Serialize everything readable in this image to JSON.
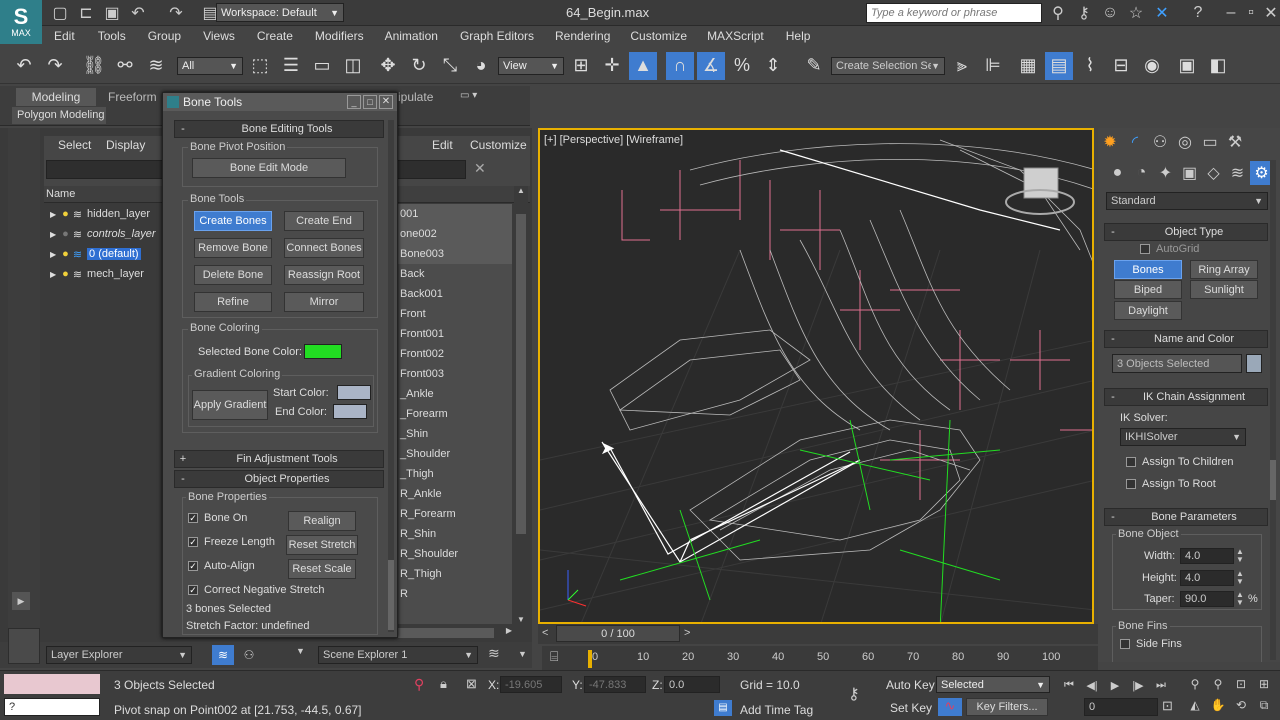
{
  "title_bar": {
    "logo_text": "MAX",
    "workspace": "Workspace: Default",
    "file_title": "64_Begin.max",
    "search_placeholder": "Type a keyword or phrase"
  },
  "menu": [
    "Edit",
    "Tools",
    "Group",
    "Views",
    "Create",
    "Modifiers",
    "Animation",
    "Graph Editors",
    "Rendering",
    "Customize",
    "MAXScript",
    "Help"
  ],
  "main_toolbar": {
    "filter": "All",
    "ref_coord": "View",
    "selection_set_placeholder": "Create Selection Se"
  },
  "ribbon": {
    "tabs": [
      "Modeling",
      "Freeform"
    ],
    "partial_tab": "ipulate",
    "sub": "Polygon Modeling"
  },
  "scene_explorer": {
    "tabs": [
      "Select",
      "Display"
    ],
    "tabs_right": [
      "Edit",
      "Customize"
    ],
    "header": "Name",
    "layers": [
      {
        "name": "hidden_layer",
        "italic": false,
        "selected": false
      },
      {
        "name": "controls_layer",
        "italic": true,
        "selected": false
      },
      {
        "name": "0 (default)",
        "italic": false,
        "selected": true
      },
      {
        "name": "mech_layer",
        "italic": false,
        "selected": false
      }
    ],
    "right_rows": [
      "001",
      "one002",
      "Bone003",
      "Back",
      "Back001",
      "Front",
      "Front001",
      "Front002",
      "Front003",
      "_Ankle",
      "_Forearm",
      "_Shin",
      "_Shoulder",
      "_Thigh",
      "R_Ankle",
      "R_Forearm",
      "R_Shin",
      "R_Shoulder",
      "R_Thigh",
      "R"
    ],
    "bottom_left": "Layer Explorer",
    "bottom_right": "Scene Explorer 1"
  },
  "bone_tools": {
    "title": "Bone Tools",
    "editing_rollout": "Bone Editing Tools",
    "pivot_group": "Bone Pivot Position",
    "bone_edit_mode": "Bone Edit Mode",
    "tools_group": "Bone Tools",
    "create_bones": "Create Bones",
    "create_end": "Create End",
    "remove_bone": "Remove Bone",
    "connect_bones": "Connect Bones",
    "delete_bone": "Delete Bone",
    "reassign_root": "Reassign Root",
    "refine": "Refine",
    "mirror": "Mirror",
    "coloring_group": "Bone Coloring",
    "selected_bone_color_label": "Selected Bone Color:",
    "selected_bone_color": "#22dd22",
    "gradient_group": "Gradient Coloring",
    "apply_gradient": "Apply Gradient",
    "start_color_label": "Start Color:",
    "end_color_label": "End Color:",
    "gradient_swatch_color": "#aab4c6",
    "fin_rollout": "Fin Adjustment Tools",
    "object_rollout": "Object Properties",
    "props_group": "Bone Properties",
    "bone_on": "Bone On",
    "realign": "Realign",
    "freeze_length": "Freeze Length",
    "reset_stretch": "Reset Stretch",
    "auto_align": "Auto-Align",
    "reset_scale": "Reset Scale",
    "correct_negative_stretch": "Correct Negative Stretch",
    "bones_selected": "3 bones Selected",
    "stretch_factor": "Stretch Factor: undefined"
  },
  "viewport": {
    "label": "[+] [Perspective] [Wireframe]",
    "frame_counter": "0 / 100"
  },
  "command_panel": {
    "category": "Standard",
    "object_type_rollout": "Object Type",
    "autogrid": "AutoGrid",
    "bones": "Bones",
    "ring_array": "Ring Array",
    "biped": "Biped",
    "sunlight": "Sunlight",
    "daylight": "Daylight",
    "name_color_rollout": "Name and Color",
    "name_field": "3 Objects Selected",
    "ik_rollout": "IK Chain Assignment",
    "ik_solver_label": "IK Solver:",
    "ik_solver": "IKHISolver",
    "assign_children": "Assign To Children",
    "assign_root": "Assign To Root",
    "bone_params_rollout": "Bone Parameters",
    "bone_object_group": "Bone Object",
    "width_label": "Width:",
    "width": "4.0",
    "height_label": "Height:",
    "height": "4.0",
    "taper_label": "Taper:",
    "taper": "90.0",
    "taper_unit": "%",
    "bone_fins_group": "Bone Fins",
    "side_fins": "Side Fins"
  },
  "timeline": {
    "ticks": [
      "0",
      "10",
      "20",
      "30",
      "40",
      "50",
      "60",
      "70",
      "80",
      "90",
      "100"
    ]
  },
  "status": {
    "objects_selected": "3 Objects Selected",
    "prompt": "Pivot snap on Point002 at [21.753, -44.5, 0.67]",
    "x_label": "X:",
    "x": "-19.605",
    "y_label": "Y:",
    "y": "-47.833",
    "z_label": "Z:",
    "z": "0.0",
    "grid": "Grid = 10.0",
    "add_time_tag": "Add Time Tag",
    "auto_key": "Auto Key",
    "set_key": "Set Key",
    "key_mode": "Selected",
    "key_filters": "Key Filters...",
    "frame": "0",
    "maxscript": "?"
  }
}
